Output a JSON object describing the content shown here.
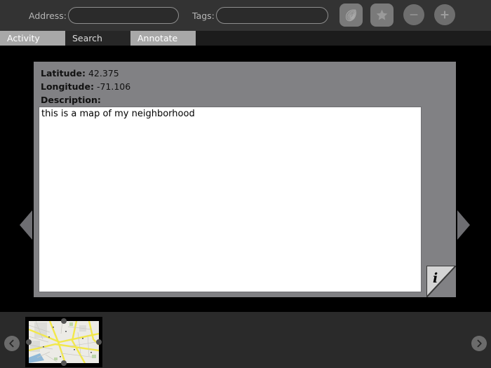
{
  "toolbar": {
    "address_label": "Address:",
    "address_value": "",
    "address_placeholder": "",
    "tags_label": "Tags:",
    "tags_value": "",
    "tags_placeholder": "",
    "buttons": [
      {
        "name": "shell-icon",
        "label": ""
      },
      {
        "name": "star-icon",
        "label": ""
      },
      {
        "name": "zoom-out-icon",
        "label": ""
      },
      {
        "name": "zoom-in-icon",
        "label": ""
      }
    ]
  },
  "tabs": [
    {
      "label": "Activity",
      "state": "inactive"
    },
    {
      "label": "Search",
      "state": "active"
    },
    {
      "label": "Annotate",
      "state": "inactive"
    }
  ],
  "panel": {
    "latitude_label": "Latitude:",
    "latitude_value": "42.375",
    "longitude_label": "Longitude:",
    "longitude_value": "-71.106",
    "description_label": "Description:",
    "description_value": "this is a map of my neighborhood",
    "description_placeholder": "",
    "info_button_glyph": "i"
  },
  "navigation": {
    "left_label": "",
    "right_label": "",
    "up_label": "",
    "down_label": ""
  },
  "filmstrip": {
    "prev_label": "‹",
    "next_label": "›",
    "thumbnail_alt": "map-thumbnail"
  },
  "colors": {
    "toolbar_bg": "#333333",
    "tabbar_bg": "#1c1c1c",
    "tab_inactive_bg": "#a8a8a8",
    "tab_active_bg": "#272727",
    "stage_bg": "#000000",
    "panel_bg": "#818184",
    "textarea_bg": "#ffffff",
    "arrow_gray": "#6e6e72",
    "filmstrip_bg": "#2a2a2a",
    "map_road": "#f2e84b",
    "map_water": "#8fb8d8",
    "map_land": "#ecebe6"
  }
}
